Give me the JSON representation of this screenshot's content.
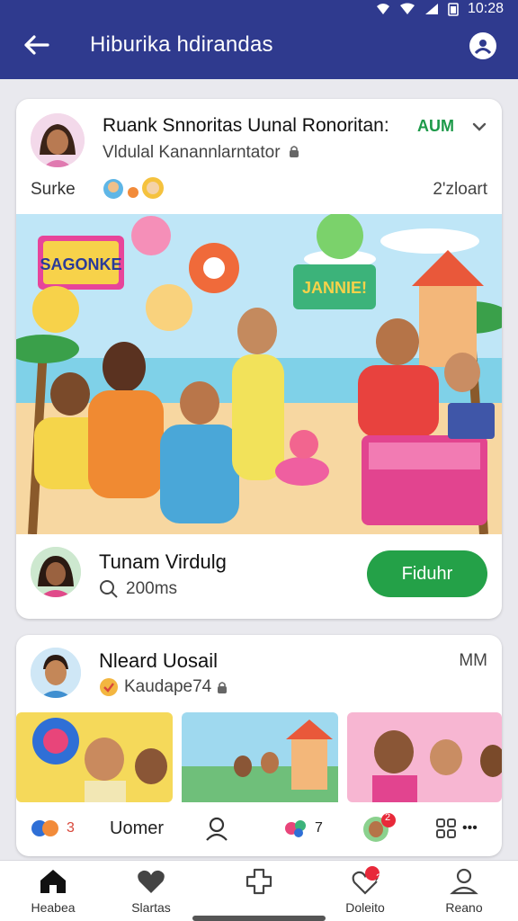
{
  "status_bar": {
    "time": "10:28"
  },
  "app_bar": {
    "title": "Hiburika hdirandas"
  },
  "post1": {
    "title": "Ruank Snnoritas Uunal Ronoritan:",
    "tag": "AUM",
    "subtitle": "Vldulal Kanannlarntator",
    "share_label": "Surke",
    "count": "2'zloart",
    "banner_sign_left": "SAGONKE",
    "banner_sign_right": "JANNIE!",
    "footer_title": "Tunam Virdulg",
    "footer_meta": "200ms",
    "follow_label": "Fiduhr",
    "accent_color": "#24a148"
  },
  "post2": {
    "title": "Nleard Uosail",
    "subtitle": "Kaudape74",
    "time": "MM",
    "actions": [
      {
        "icon": "reaction-icon",
        "label": "3"
      },
      {
        "icon": "user-icon",
        "label": "Uomer"
      },
      {
        "icon": "share-icon",
        "label": "7"
      },
      {
        "icon": "avatar-icon",
        "label": "2"
      },
      {
        "icon": "more-icon",
        "label": "•••"
      }
    ]
  },
  "bottom_nav": {
    "items": [
      {
        "icon": "home-icon",
        "label": "Heabea"
      },
      {
        "icon": "heart-icon",
        "label": "Slartas"
      },
      {
        "icon": "add-icon",
        "label": ""
      },
      {
        "icon": "notification-icon",
        "label": "Doleito",
        "badge": "2"
      },
      {
        "icon": "profile-icon",
        "label": "Reano"
      }
    ]
  },
  "colors": {
    "app_bar": "#2f3a8e",
    "background": "#e9e9ee"
  }
}
